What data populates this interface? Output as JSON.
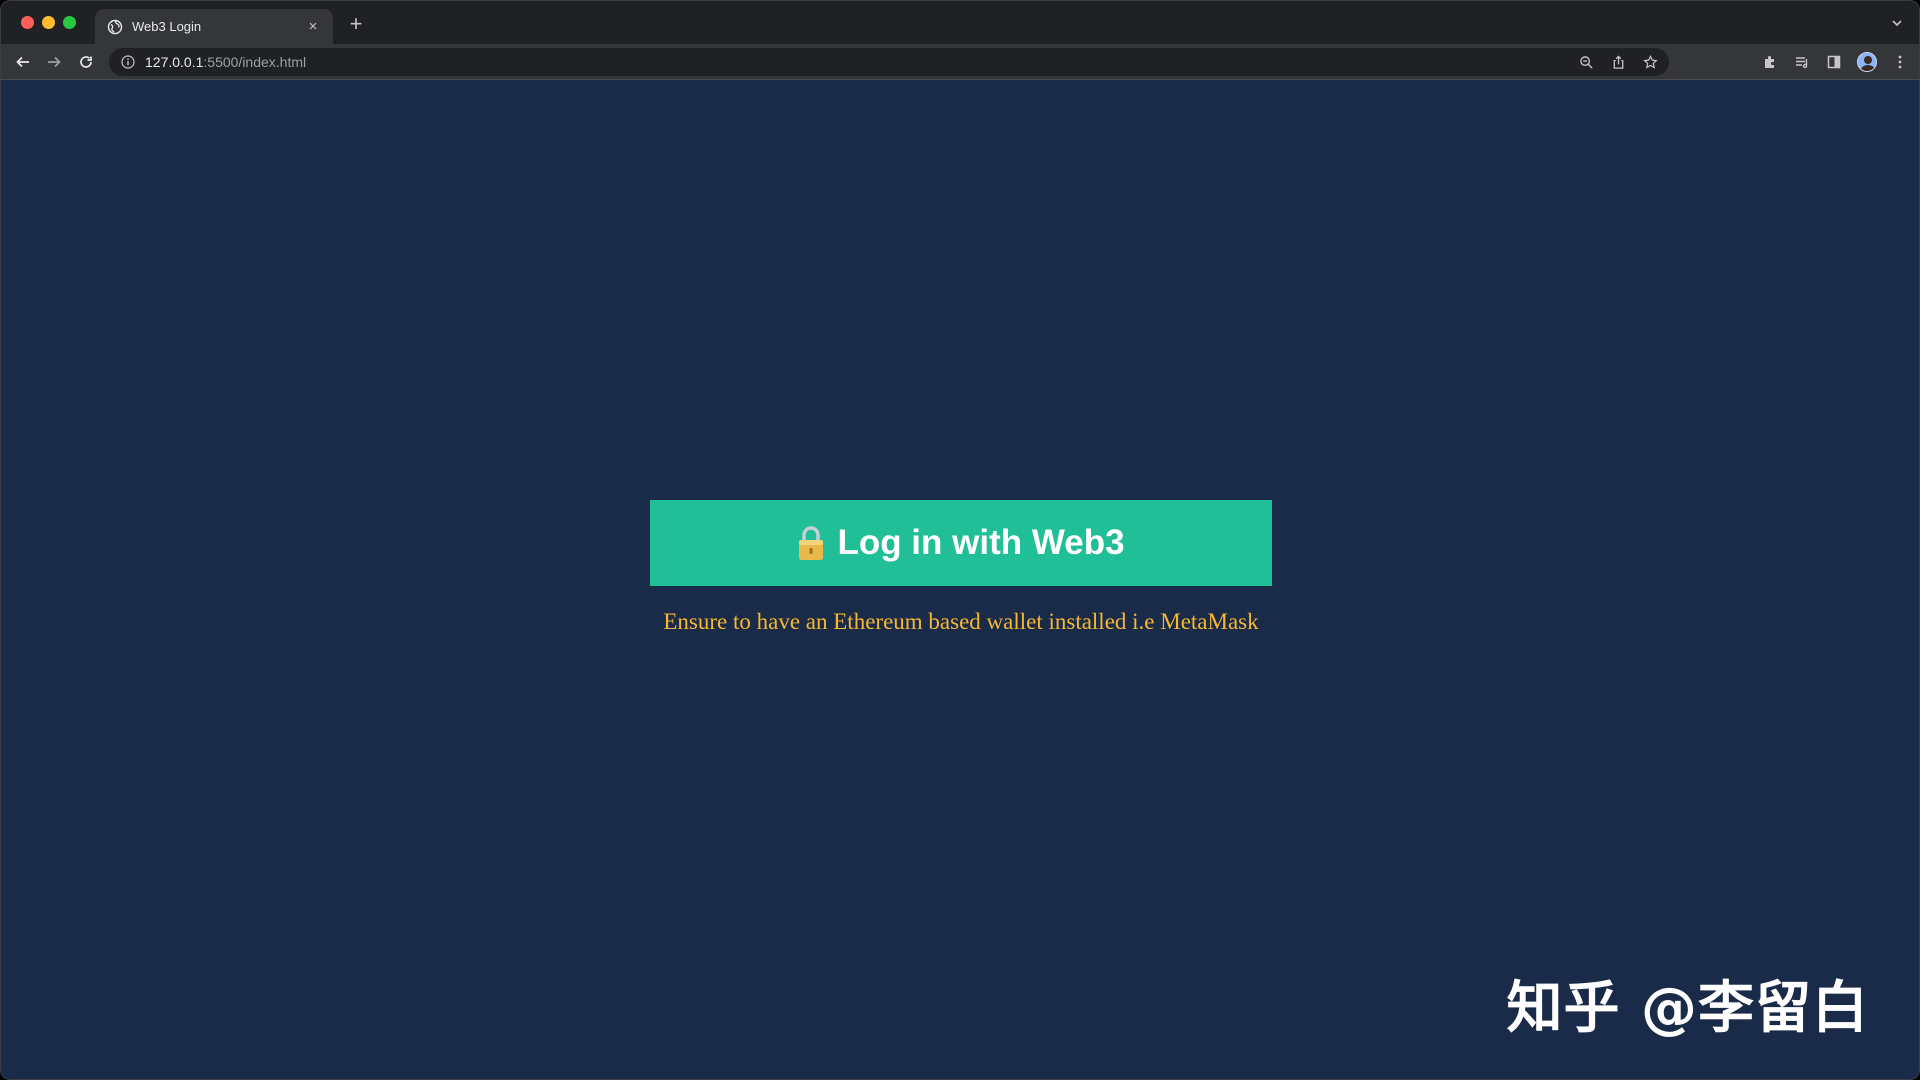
{
  "browser": {
    "tab": {
      "title": "Web3 Login",
      "favicon": "globe-icon",
      "close_glyph": "×"
    },
    "new_tab_glyph": "+",
    "url": {
      "host": "127.0.0.1",
      "rest": ":5500/index.html"
    },
    "window_controls": {
      "close_color": "#ff5f57",
      "minimize_color": "#febc2e",
      "zoom_color": "#28c840"
    }
  },
  "page": {
    "background_color": "#192b49",
    "login_button": {
      "label": "Log in with Web3",
      "icon": "lock-icon",
      "color": "#20bf98"
    },
    "notice": {
      "text": "Ensure to have an Ethereum based wallet installed i.e MetaMask",
      "color": "#f7b731"
    },
    "watermark": {
      "text": "知乎 @李留白"
    }
  }
}
